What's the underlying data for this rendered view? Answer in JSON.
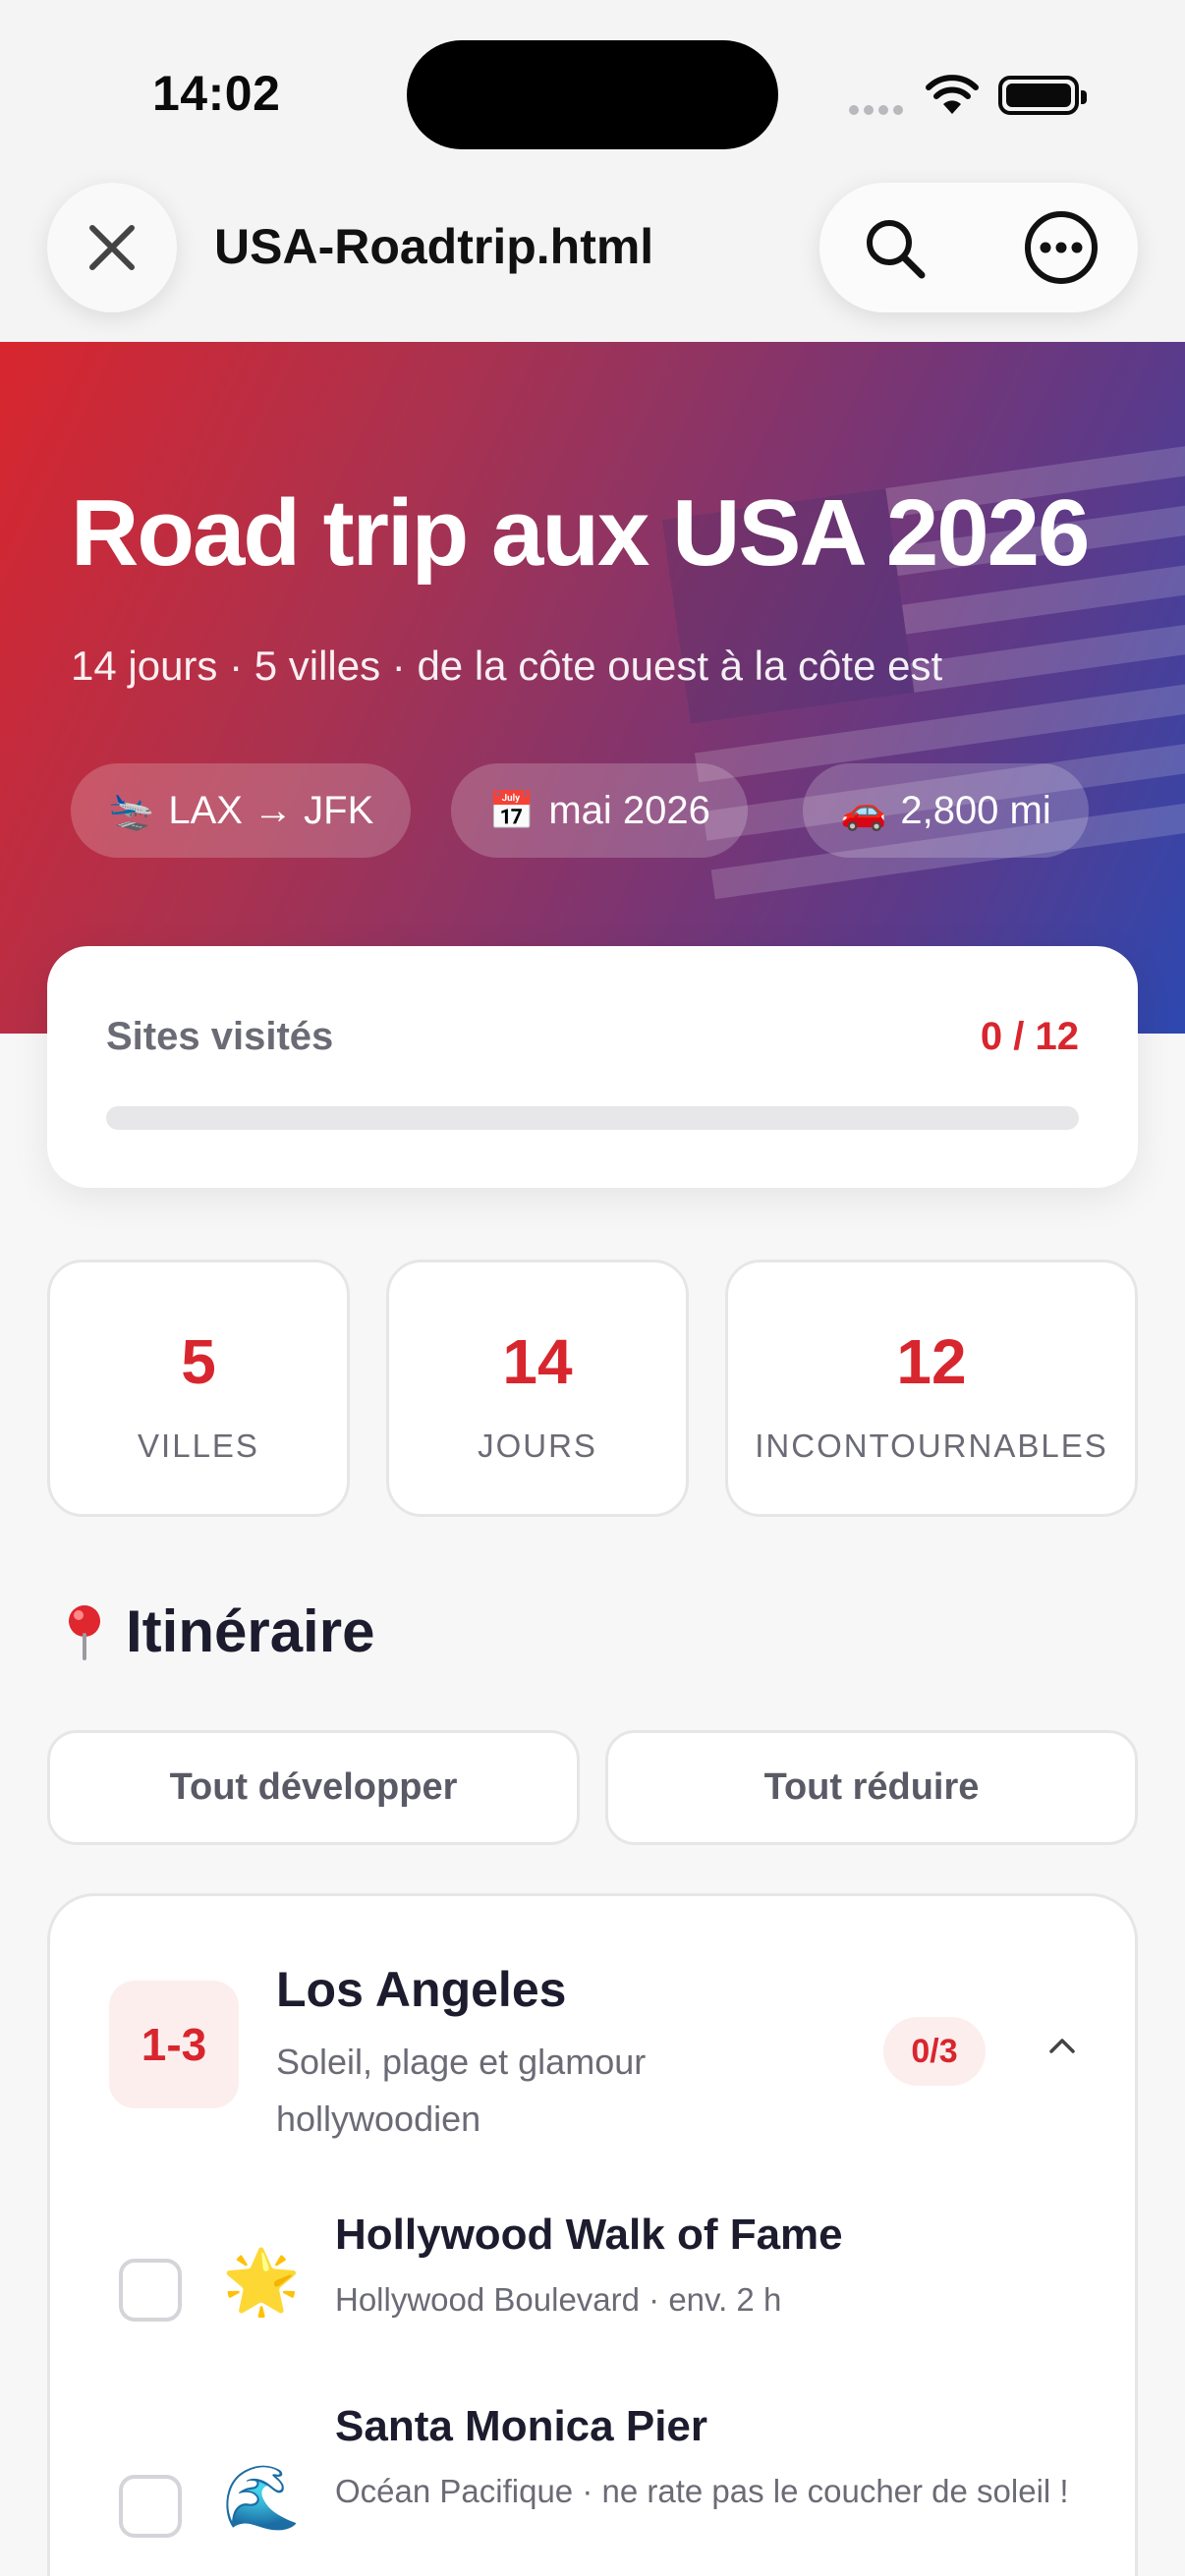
{
  "status_bar": {
    "time": "14:02"
  },
  "browser": {
    "title": "USA-Roadtrip.html"
  },
  "hero": {
    "title": "Road trip aux USA 2026",
    "subtitle": "14 jours · 5 villes · de la côte ouest à la côte est",
    "chips": [
      {
        "emoji": "🛬",
        "label": "LAX → JFK"
      },
      {
        "emoji": "📅",
        "label": "mai 2026"
      },
      {
        "emoji": "🚗",
        "label": "2,800 mi"
      }
    ]
  },
  "progress": {
    "label": "Sites visités",
    "count": "0 / 12",
    "fraction": 0
  },
  "stats": [
    {
      "value": "5",
      "label": "VILLES"
    },
    {
      "value": "14",
      "label": "JOURS"
    },
    {
      "value": "12",
      "label": "INCONTOURNABLES"
    }
  ],
  "itinerary": {
    "title": "Itinéraire",
    "expand_all": "Tout développer",
    "collapse_all": "Tout réduire",
    "cities": [
      {
        "days": "1-3",
        "name": "Los Angeles",
        "description": "Soleil, plage et glamour hollywoodien",
        "count": "0/3",
        "sites": [
          {
            "emoji": "🌟",
            "name": "Hollywood Walk of Fame",
            "description": "Hollywood Boulevard · env. 2 h"
          },
          {
            "emoji": "🌊",
            "name": "Santa Monica Pier",
            "description": "Océan Pacifique · ne rate pas le coucher de soleil !"
          }
        ]
      }
    ]
  },
  "colors": {
    "accent": "#d8262e",
    "hero_start": "#d8262e",
    "hero_end": "#2d48b0"
  }
}
